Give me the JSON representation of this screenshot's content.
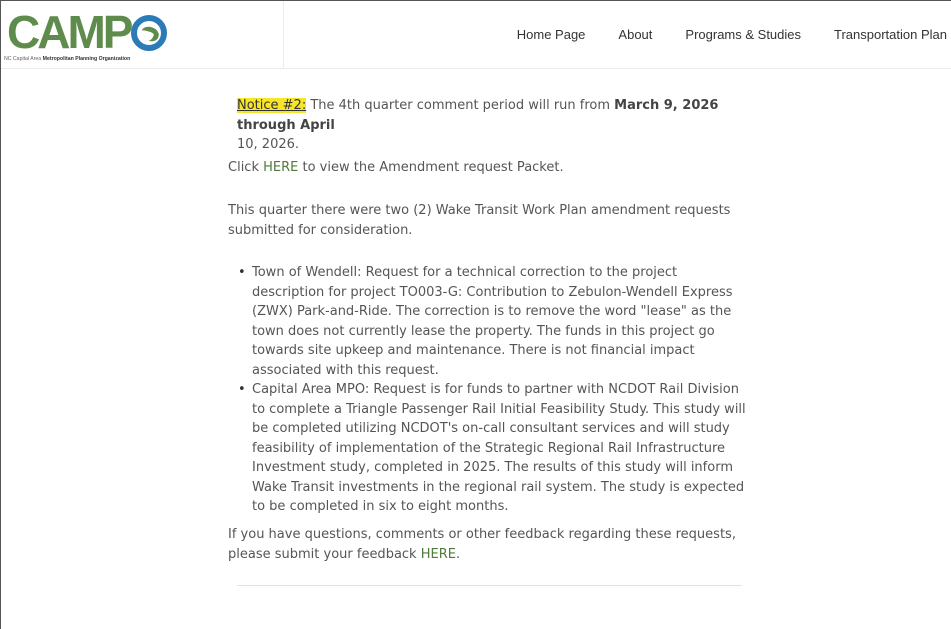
{
  "header": {
    "logo_text": "CAMPO",
    "logo_tagline_a": "NC Capital Area",
    "logo_tagline_b": "Metropolitan Planning Organization",
    "nav": [
      {
        "label": "Home Page"
      },
      {
        "label": "About"
      },
      {
        "label": "Programs & Studies"
      },
      {
        "label": "Transportation Plan"
      }
    ]
  },
  "notice": {
    "label": "Notice #2:",
    "text_a": " The 4th quarter comment period will run from ",
    "dates": "March 9, 2026 through April",
    "text_b": "10, 2026."
  },
  "packet": {
    "prefix": "Click ",
    "link": "HERE",
    "suffix": " to view the Amendment request Packet."
  },
  "intro": "This quarter there were two (2) Wake Transit Work Plan amendment requests submitted for consideration.",
  "requests": [
    {
      "text": "Town of Wendell: Request for a technical correction to the project description for project TO003-G: Contribution to Zebulon-Wendell Express (ZWX) Park-and-Ride. The correction is to remove the word \"lease\" as the town does not currently lease the property. The funds in this project go towards site upkeep and maintenance. There is not financial impact associated with this request."
    },
    {
      "text": " Capital Area MPO: Request is for funds to partner with NCDOT Rail Division to complete a Triangle Passenger Rail Initial Feasibility Study. This study will be completed utilizing NCDOT's on-call consultant services and will study feasibility of implementation of the Strategic Regional Rail Infrastructure Investment study, completed in 2025. The results of this study will inform Wake Transit investments in the regional rail system. The study is expected to be completed in six to eight months."
    }
  ],
  "feedback": {
    "text": "If you have questions, comments or other feedback regarding these requests, please submit your feedback ",
    "link": "HERE",
    "suffix": "."
  },
  "colors": {
    "brand_green": "#5f8c4c",
    "brand_blue": "#2b7bb9",
    "highlight": "#f7e52a",
    "link": "#4f7b3a"
  }
}
